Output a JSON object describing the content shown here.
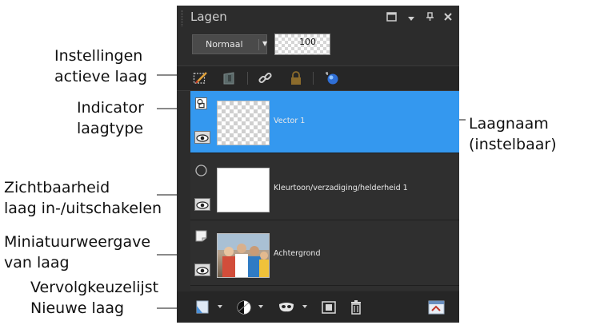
{
  "panel": {
    "title": "Lagen",
    "window_controls": [
      "restore-icon",
      "menu-arrow-icon",
      "pin-icon",
      "close-icon"
    ],
    "blend_mode": "Normaal",
    "opacity": "100",
    "toolbar_icons": [
      "layer-settings-icon",
      "mask-icon",
      "link-icon",
      "lock-icon",
      "effects-sphere-icon"
    ],
    "layers": [
      {
        "name": "Vector 1",
        "type_icon": "vector-layer-icon",
        "selected": true,
        "thumbnail": "transparent"
      },
      {
        "name": "Kleurtoon/verzadiging/helderheid 1",
        "type_icon": "adjustment-layer-icon",
        "selected": false,
        "thumbnail": "white"
      },
      {
        "name": "Achtergrond",
        "type_icon": "raster-layer-icon",
        "selected": false,
        "thumbnail": "photo"
      }
    ],
    "bottom_icons": [
      "new-layer-icon",
      "new-adjustment-icon",
      "new-mask-icon",
      "merge-icon",
      "delete-icon",
      "layer-properties-icon"
    ]
  },
  "annotations": {
    "settings": [
      "Instellingen",
      "actieve laag"
    ],
    "type": [
      "Indicator",
      "laagtype"
    ],
    "visibility": [
      "Zichtbaarheid",
      "laag in-/uitschakelen"
    ],
    "thumbnail": [
      "Miniatuurweergave",
      "van laag"
    ],
    "newlayer": [
      "Vervolgkeuzelijst",
      "Nieuwe laag"
    ],
    "name": [
      "Laagnaam",
      "(instelbaar)"
    ]
  },
  "colors": {
    "panel_bg": "#2c2c2c",
    "selected_row": "#3498ef",
    "annotation_line": "#8a8a8a"
  }
}
